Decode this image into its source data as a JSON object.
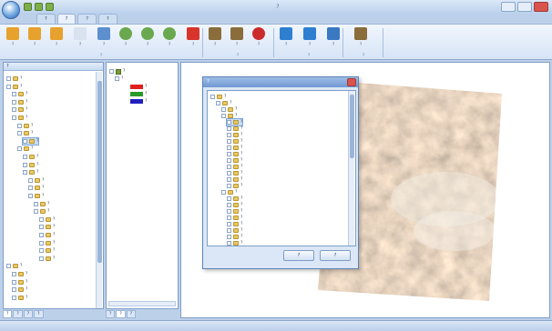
{
  "window": {
    "title": "?"
  },
  "colors": {
    "ribbon_bg": "#dce8f7",
    "legend_red": "#e02020",
    "legend_green": "#2a9a2a",
    "legend_blue": "#2020c0",
    "close_red": "#d9534f"
  },
  "quick_access": {
    "icons": [
      "save-icon",
      "undo-icon",
      "redo-icon"
    ]
  },
  "ribbon": {
    "tabs": [
      "?",
      "?",
      "?",
      "?"
    ],
    "active_tab_index": 1,
    "buttons": [
      {
        "label": "?",
        "icon": "folder-icon"
      },
      {
        "label": "?",
        "icon": "folder-icon"
      },
      {
        "label": "?",
        "icon": "folder-icon"
      },
      {
        "label": "?",
        "icon": "document-icon"
      },
      {
        "label": "?",
        "icon": "search-icon"
      },
      {
        "label": "?",
        "icon": "globe-icon"
      },
      {
        "label": "?",
        "icon": "globe-icon"
      },
      {
        "label": "?",
        "icon": "globe-icon"
      },
      {
        "label": "?",
        "icon": "delete-x-icon"
      },
      {
        "label": "?",
        "icon": "book-icon"
      },
      {
        "label": "?",
        "icon": "book-icon"
      },
      {
        "label": "?",
        "icon": "stop-icon"
      },
      {
        "label": "?",
        "icon": "arrow-up-icon"
      },
      {
        "label": "?",
        "icon": "arrow-up-icon"
      },
      {
        "label": "?",
        "icon": "download-icon"
      },
      {
        "label": "?",
        "icon": "book-icon"
      }
    ],
    "groups": [
      "?",
      "?",
      "?",
      "?"
    ]
  },
  "left_panel": {
    "title": "?",
    "tree": [
      "?",
      "?",
      "?",
      "?",
      "?",
      "?",
      "?",
      "?",
      "?",
      "?",
      "?",
      "?",
      "?",
      "?",
      "?",
      "?",
      "?",
      "?",
      "?",
      "?",
      "?",
      "?",
      "?",
      "?",
      "?",
      "?",
      "?",
      "?",
      "?"
    ],
    "bottom_tabs": [
      "?",
      "?",
      "?",
      "?"
    ]
  },
  "layer_panel": {
    "root": "?",
    "layer_name": "?",
    "legend": [
      "?",
      "?",
      "?"
    ],
    "bottom_tabs": [
      "?",
      "?",
      "?"
    ]
  },
  "dialog": {
    "title": "?",
    "tree": [
      "?",
      "?",
      "?",
      "?",
      "?",
      "?",
      "?",
      "?",
      "?",
      "?",
      "?",
      "?",
      "?",
      "?",
      "?",
      "?",
      "?",
      "?",
      "?",
      "?",
      "?",
      "?",
      "?",
      "?"
    ],
    "ok_label": "?",
    "cancel_label": "?"
  }
}
